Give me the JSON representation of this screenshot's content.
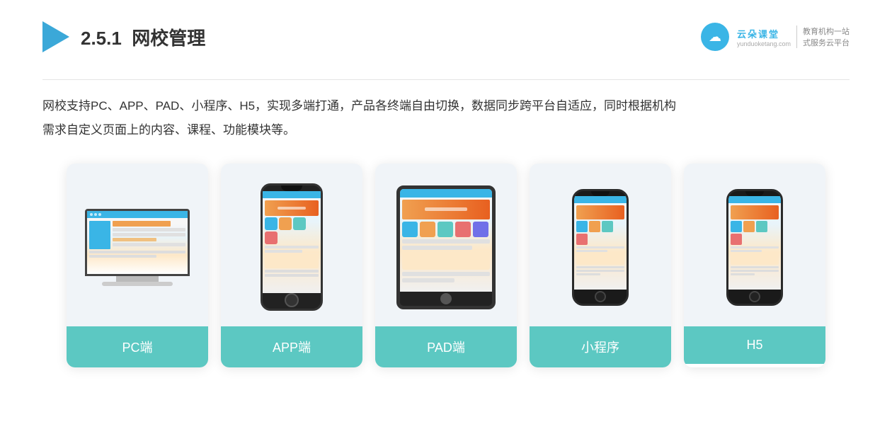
{
  "header": {
    "section_number": "2.5.1",
    "title": "网校管理",
    "logo_alt": "云朵课堂",
    "brand_url": "yunduoketang.com",
    "brand_slogan_line1": "教育机构一站",
    "brand_slogan_line2": "式服务云平台"
  },
  "description": {
    "text": "网校支持PC、APP、PAD、小程序、H5，实现多端打通，产品各终端自由切换，数据同步跨平台自适应，同时根据机构",
    "text2": "需求自定义页面上的内容、课程、功能模块等。"
  },
  "cards": [
    {
      "id": "pc",
      "label": "PC端"
    },
    {
      "id": "app",
      "label": "APP端"
    },
    {
      "id": "pad",
      "label": "PAD端"
    },
    {
      "id": "mini",
      "label": "小程序"
    },
    {
      "id": "h5",
      "label": "H5"
    }
  ]
}
